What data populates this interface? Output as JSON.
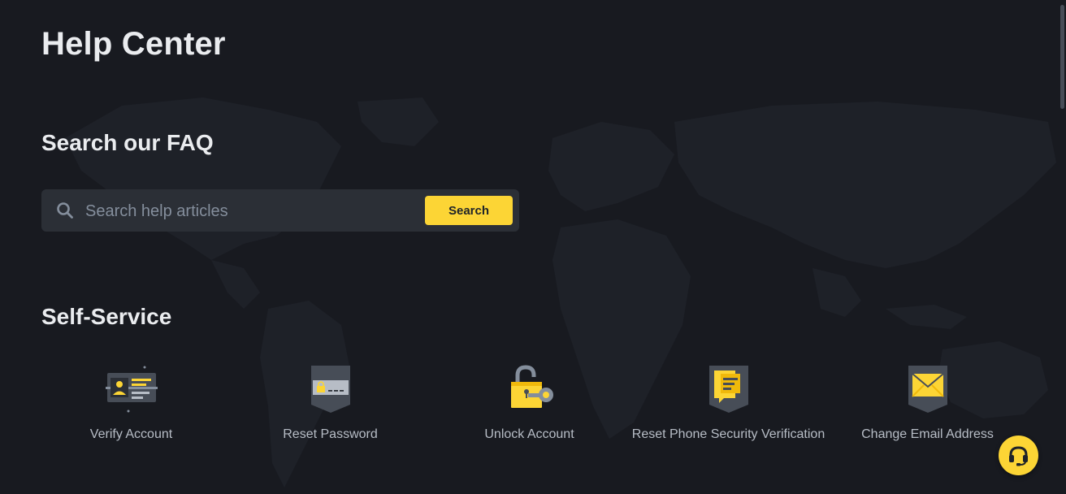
{
  "page": {
    "title": "Help Center"
  },
  "faq": {
    "heading": "Search our FAQ",
    "search_placeholder": "Search help articles",
    "search_button_label": "Search"
  },
  "self_service": {
    "heading": "Self-Service",
    "items": [
      {
        "label": "Verify Account",
        "icon": "id-card-icon"
      },
      {
        "label": "Reset Password",
        "icon": "password-shield-icon"
      },
      {
        "label": "Unlock Account",
        "icon": "unlock-key-icon"
      },
      {
        "label": "Reset Phone Security Verification",
        "icon": "phone-verification-shield-icon"
      },
      {
        "label": "Change Email Address",
        "icon": "email-shield-icon"
      }
    ]
  },
  "support": {
    "icon": "headset-icon"
  },
  "colors": {
    "background": "#181a20",
    "accent": "#fcd535",
    "input_bg": "#2b2f36",
    "muted_text": "#b7bdc6"
  }
}
